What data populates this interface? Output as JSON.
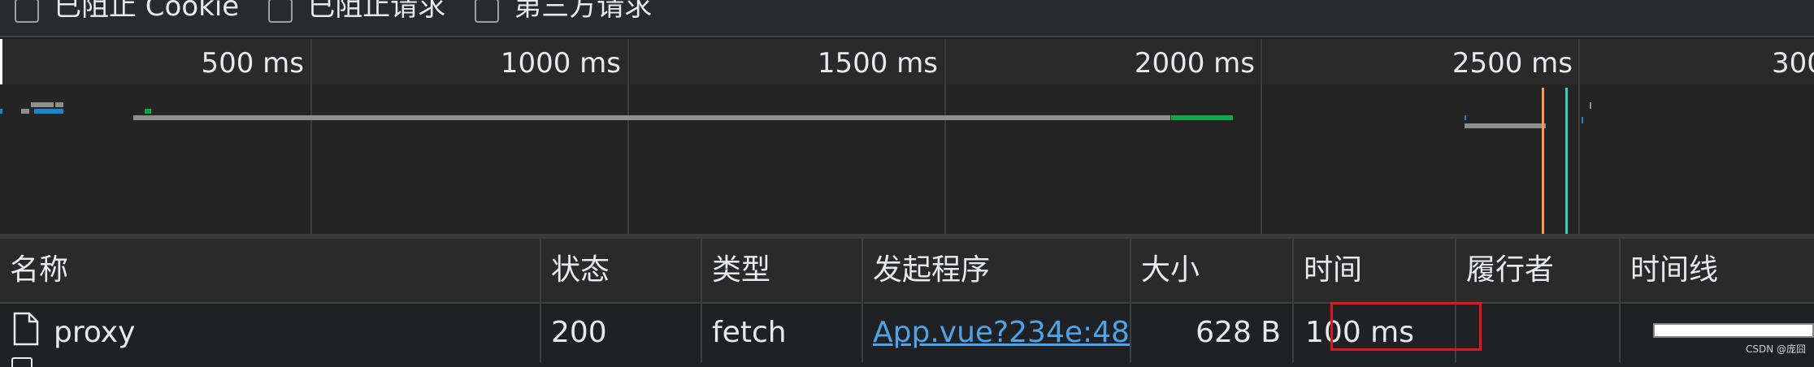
{
  "filters": [
    {
      "label": "已阻止 Cookie",
      "checked": false
    },
    {
      "label": "已阻止请求",
      "checked": false
    },
    {
      "label": "第三方请求",
      "checked": false
    }
  ],
  "overview": {
    "ticks": [
      "500 ms",
      "1000 ms",
      "1500 ms",
      "2000 ms",
      "2500 ms",
      "300"
    ]
  },
  "table": {
    "columns": [
      "名称",
      "状态",
      "类型",
      "发起程序",
      "大小",
      "时间",
      "履行者",
      "时间线"
    ],
    "rows": [
      {
        "name": "proxy",
        "status": "200",
        "type": "fetch",
        "initiator": "App.vue?234e:48",
        "size": "628 B",
        "time": "100 ms",
        "fulfilled_by": ""
      }
    ]
  },
  "watermark": "CSDN @庞囧",
  "colors": {
    "accent_link": "#4fa3e8",
    "highlight": "#e5151b",
    "bar_waiting": "#8f8f8f",
    "bar_download": "#0fa84f",
    "bar_blue": "#1a88d1",
    "marker_orange": "#f59e5a",
    "marker_cyan": "#33d1c6"
  }
}
